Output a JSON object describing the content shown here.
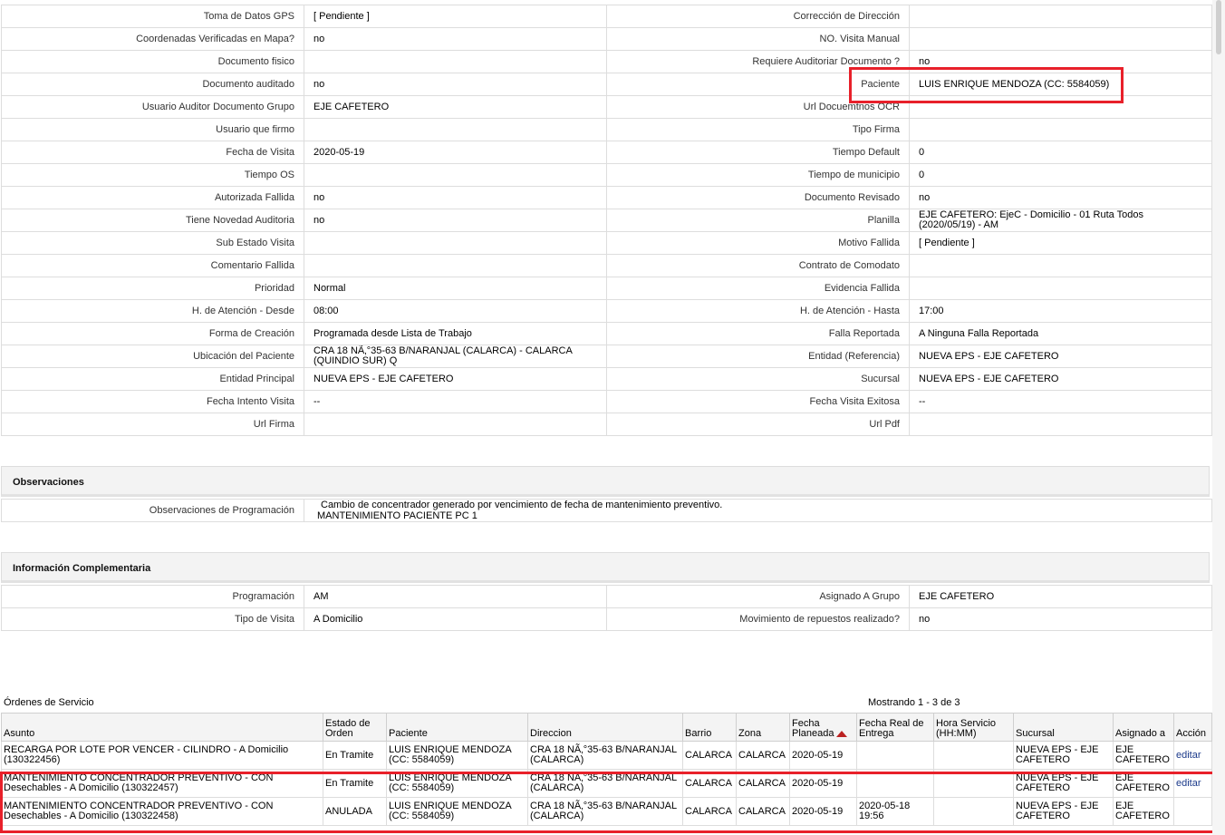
{
  "details": {
    "rows": [
      {
        "l1": "Toma de Datos GPS",
        "v1": "[ Pendiente ]",
        "l2": "Corrección de Dirección",
        "v2": ""
      },
      {
        "l1": "Coordenadas Verificadas en Mapa?",
        "v1": "no",
        "l2": "NO. Visita Manual",
        "v2": ""
      },
      {
        "l1": "Documento fisico",
        "v1": "",
        "l2": "Requiere Auditoriar Documento ?",
        "v2": "no"
      },
      {
        "l1": "Documento auditado",
        "v1": "no",
        "l2": "Paciente",
        "v2": "LUIS ENRIQUE MENDOZA (CC: 5584059)"
      },
      {
        "l1": "Usuario Auditor Documento Grupo",
        "v1": "EJE CAFETERO",
        "l2": "Url Docuemtnos OCR",
        "v2": ""
      },
      {
        "l1": "Usuario que firmo",
        "v1": "",
        "l2": "Tipo Firma",
        "v2": ""
      },
      {
        "l1": "Fecha de Visita",
        "v1": "2020-05-19",
        "l2": "Tiempo Default",
        "v2": "0"
      },
      {
        "l1": "Tiempo OS",
        "v1": "",
        "l2": "Tiempo de municipio",
        "v2": "0"
      },
      {
        "l1": "Autorizada Fallida",
        "v1": "no",
        "l2": "Documento Revisado",
        "v2": "no"
      },
      {
        "l1": "Tiene Novedad Auditoria",
        "v1": "no",
        "l2": "Planilla",
        "v2": "EJE CAFETERO: EjeC - Domicilio - 01 Ruta Todos (2020/05/19) - AM"
      },
      {
        "l1": "Sub Estado Visita",
        "v1": "",
        "l2": "Motivo Fallida",
        "v2": "[ Pendiente ]"
      },
      {
        "l1": "Comentario Fallida",
        "v1": "",
        "l2": "Contrato de Comodato",
        "v2": ""
      },
      {
        "l1": "Prioridad",
        "v1": "Normal",
        "l2": "Evidencia Fallida",
        "v2": ""
      },
      {
        "l1": "H. de Atención - Desde",
        "v1": "08:00",
        "l2": "H. de Atención - Hasta",
        "v2": "17:00"
      },
      {
        "l1": "Forma de Creación",
        "v1": "Programada desde Lista de Trabajo",
        "l2": "Falla Reportada",
        "v2": "A Ninguna Falla Reportada"
      },
      {
        "l1": "Ubicación del Paciente",
        "v1": "CRA 18 NÃ‚°35-63 B/NARANJAL (CALARCA) - CALARCA (QUINDIO SUR) Q",
        "l2": "Entidad (Referencia)",
        "v2": "NUEVA EPS - EJE CAFETERO"
      },
      {
        "l1": "Entidad Principal",
        "v1": "NUEVA EPS - EJE CAFETERO",
        "l2": "Sucursal",
        "v2": "NUEVA EPS - EJE CAFETERO"
      },
      {
        "l1": "Fecha Intento Visita",
        "v1": "--",
        "l2": "Fecha Visita Exitosa",
        "v2": "--"
      },
      {
        "l1": "Url Firma",
        "v1": "",
        "l2": "Url Pdf",
        "v2": ""
      }
    ]
  },
  "observaciones": {
    "title": "Observaciones",
    "label": "Observaciones de Programación",
    "line1": "Cambio de concentrador generado por vencimiento de fecha de mantenimiento preventivo.",
    "line2": "MANTENIMIENTO PACIENTE PC 1"
  },
  "complementaria": {
    "title": "Información Complementaria",
    "rows": [
      {
        "l1": "Programación",
        "v1": "AM",
        "l2": "Asignado A Grupo",
        "v2": "EJE CAFETERO"
      },
      {
        "l1": "Tipo de Visita",
        "v1": "A Domicilio",
        "l2": "Movimiento de repuestos realizado?",
        "v2": "no"
      }
    ]
  },
  "ordenes": {
    "title": "Órdenes de Servicio",
    "count": "Mostrando 1 - 3 de 3",
    "headers": [
      "Asunto",
      "Estado de Orden",
      "Paciente",
      "Direccion",
      "Barrio",
      "Zona",
      "Fecha Planeada",
      "Fecha Real de Entrega",
      "Hora Servicio (HH:MM)",
      "Sucursal",
      "Asignado a",
      "Acción"
    ],
    "rows": [
      {
        "asunto": "RECARGA POR LOTE POR VENCER - CILINDRO - A Domicilio (130322456)",
        "estado": "En Tramite",
        "paciente": "LUIS ENRIQUE MENDOZA (CC: 5584059)",
        "direccion": "CRA 18 NÃ‚°35-63 B/NARANJAL (CALARCA)",
        "barrio": "CALARCA",
        "zona": "CALARCA",
        "fecha_planeada": "2020-05-19",
        "fecha_real": "",
        "hora": "",
        "sucursal": "NUEVA EPS - EJE CAFETERO",
        "asignado": "EJE CAFETERO",
        "accion": "editar"
      },
      {
        "asunto": "MANTENIMIENTO CONCENTRADOR PREVENTIVO - CON Desechables - A Domicilio (130322457)",
        "estado": "En Tramite",
        "paciente": "LUIS ENRIQUE MENDOZA (CC: 5584059)",
        "direccion": "CRA 18 NÃ‚°35-63 B/NARANJAL (CALARCA)",
        "barrio": "CALARCA",
        "zona": "CALARCA",
        "fecha_planeada": "2020-05-19",
        "fecha_real": "",
        "hora": "",
        "sucursal": "NUEVA EPS - EJE CAFETERO",
        "asignado": "EJE CAFETERO",
        "accion": "editar"
      },
      {
        "asunto": "MANTENIMIENTO CONCENTRADOR PREVENTIVO - CON Desechables - A Domicilio (130322458)",
        "estado": "ANULADA",
        "paciente": "LUIS ENRIQUE MENDOZA (CC: 5584059)",
        "direccion": "CRA 18 NÃ‚°35-63 B/NARANJAL (CALARCA)",
        "barrio": "CALARCA",
        "zona": "CALARCA",
        "fecha_planeada": "2020-05-19",
        "fecha_real": "2020-05-18 19:56",
        "hora": "",
        "sucursal": "NUEVA EPS - EJE CAFETERO",
        "asignado": "EJE CAFETERO",
        "accion": ""
      }
    ]
  },
  "colors": {
    "highlight": "#e8202a",
    "link": "#1b3a8a"
  }
}
